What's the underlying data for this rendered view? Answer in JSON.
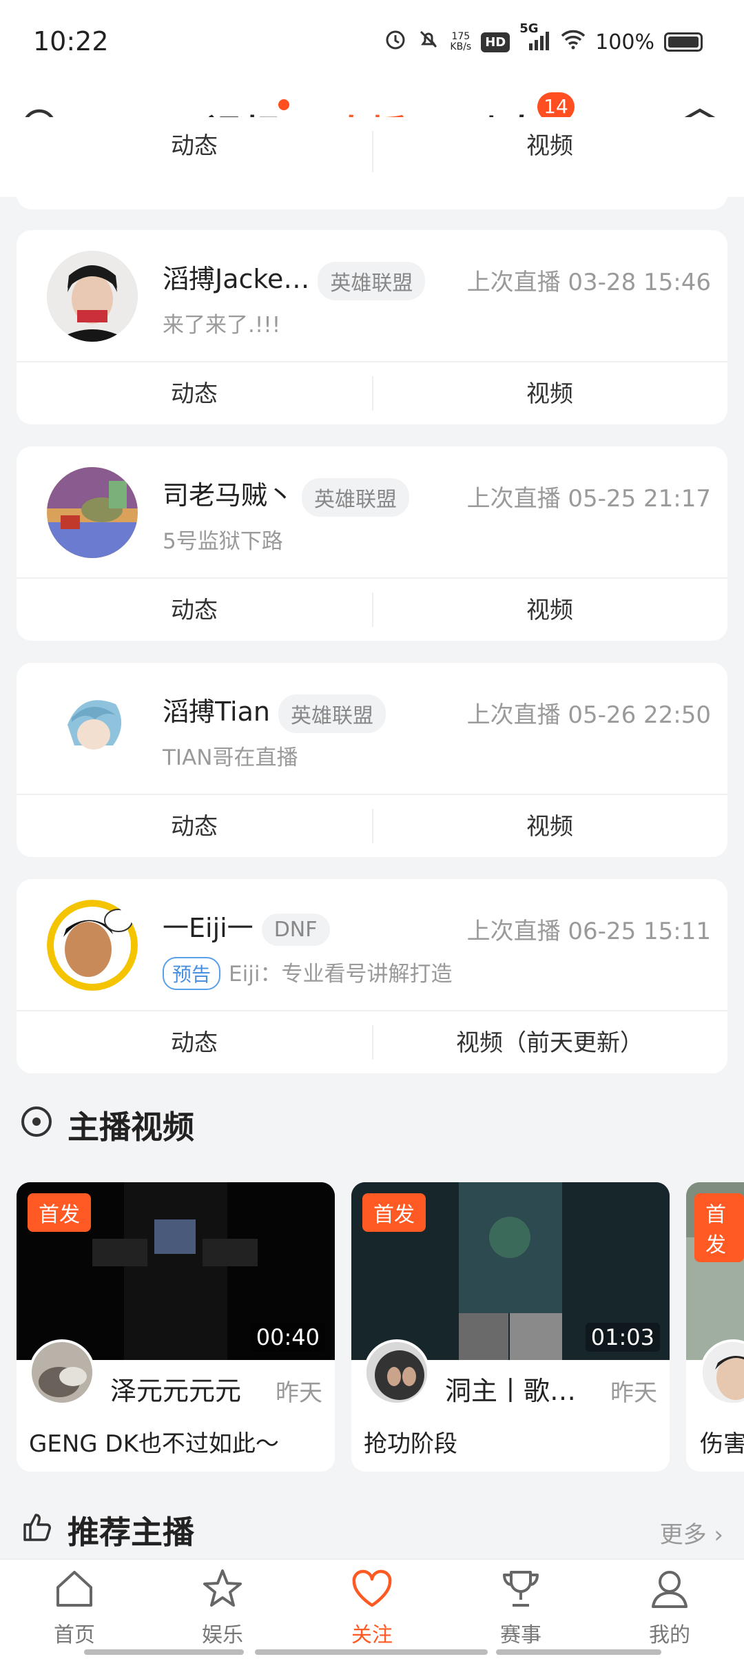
{
  "status_bar": {
    "time": "10:22",
    "net_speed": "175",
    "net_unit": "KB/s",
    "hd": "HD",
    "signal": "5G",
    "battery": "100%"
  },
  "top_nav": {
    "tabs": [
      "视频",
      "直播",
      "动态"
    ],
    "active": "直播",
    "dynamic_badge": "14"
  },
  "partial_card": {
    "left": "动态",
    "right": "视频"
  },
  "streamers": [
    {
      "name": "滔搏Jacke…",
      "tag": "英雄联盟",
      "last": "上次直播 03-28 15:46",
      "desc": "来了来了.!!!",
      "left": "动态",
      "right": "视频"
    },
    {
      "name": "司老马贼丶",
      "tag": "英雄联盟",
      "last": "上次直播 05-25 21:17",
      "desc": "5号监狱下路",
      "left": "动态",
      "right": "视频"
    },
    {
      "name": "滔搏Tian",
      "tag": "英雄联盟",
      "last": "上次直播 05-26 22:50",
      "desc": "TIAN哥在直播",
      "left": "动态",
      "right": "视频"
    },
    {
      "name": "一Eiji一",
      "tag": "DNF",
      "last": "上次直播 06-25 15:11",
      "preview": "预告",
      "desc": "Eiji：专业看号讲解打造",
      "left": "动态",
      "right": "视频（前天更新）"
    }
  ],
  "section_videos": {
    "title": "主播视频"
  },
  "videos": [
    {
      "badge": "首发",
      "duration": "00:40",
      "author": "泽元元元元",
      "time": "昨天",
      "title": "GENG DK也不过如此～"
    },
    {
      "badge": "首发",
      "duration": "01:03",
      "author": "洞主丨歌…",
      "time": "昨天",
      "title": "抢功阶段"
    },
    {
      "badge": "首发",
      "title": "伤害"
    }
  ],
  "section_recommend": {
    "title": "推荐主播",
    "more": "更多"
  },
  "bottom_nav": [
    "首页",
    "娱乐",
    "关注",
    "赛事",
    "我的"
  ],
  "accent": "#ff5a24"
}
